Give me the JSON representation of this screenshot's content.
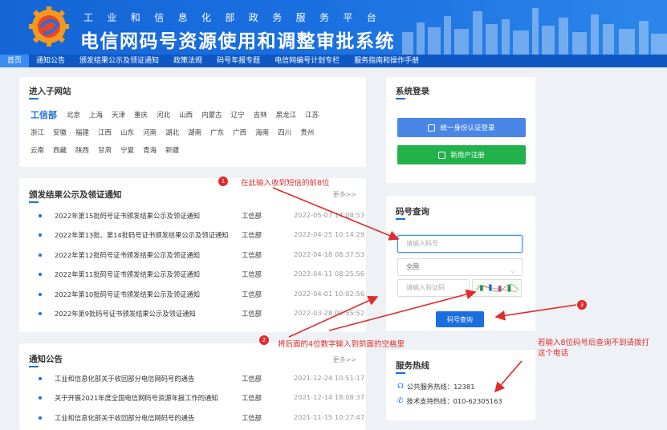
{
  "header": {
    "subtitle": "工业和信息化部政务服务平台",
    "title": "电信网码号资源使用和调整审批系统"
  },
  "nav": [
    "首页",
    "通知公告",
    "颁发结果公示及领证通知",
    "政策法规",
    "码号年报专题",
    "电信网编号计划专栏",
    "服务指南和操作手册"
  ],
  "subsites": {
    "title": "进入子网站",
    "rows": [
      [
        "工信部",
        "北京",
        "上海",
        "天津",
        "重庆",
        "河北",
        "山西",
        "内蒙古",
        "辽宁",
        "吉林",
        "黑龙江",
        "江苏"
      ],
      [
        "浙江",
        "安徽",
        "福建",
        "江西",
        "山东",
        "河南",
        "湖北",
        "湖南",
        "广东",
        "广西",
        "海南",
        "四川",
        "贵州"
      ],
      [
        "云南",
        "西藏",
        "陕西",
        "甘肃",
        "宁夏",
        "青海",
        "新疆"
      ]
    ]
  },
  "results": {
    "title": "颁发结果公示及领证通知",
    "more": "更多>>",
    "items": [
      {
        "title": "2022年第15批码号证书颁发结果公示及领证通知",
        "org": "工信部",
        "date": "2022-05-07 14:08:53"
      },
      {
        "title": "2022年第13批、第14批码号证书颁发结果公示及领证通知",
        "org": "工信部",
        "date": "2022-04-25 10:14:29"
      },
      {
        "title": "2022年第12批码号证书颁发结果公示及领证通知",
        "org": "工信部",
        "date": "2022-04-18 08:37:53"
      },
      {
        "title": "2022年第11批码号证书颁发结果公示及领证通知",
        "org": "工信部",
        "date": "2022-04-11 08:25:56"
      },
      {
        "title": "2022年第10批码号证书颁发结果公示及领证通知",
        "org": "工信部",
        "date": "2022-04-01 10:02:56"
      },
      {
        "title": "2022年第9批码号证书颁发结果公示及领证通知",
        "org": "工信部",
        "date": "2022-03-28 09:55:52"
      }
    ]
  },
  "notices": {
    "title": "通知公告",
    "more": "更多>>",
    "items": [
      {
        "title": "工业和信息化部关于收回部分电信网码号的通告",
        "org": "工信部",
        "date": "2021-12-24 10:51:17"
      },
      {
        "title": "关于开展2021年度全国电信网码号资源年报工作的通知",
        "org": "工信部",
        "date": "2021-12-14 18:08:37"
      },
      {
        "title": "工业和信息化部关于收回部分电信网码号的通告",
        "org": "工信部",
        "date": "2021-11-15 10:27:47"
      }
    ]
  },
  "login": {
    "title": "系统登录",
    "unified_login": "统一身份认证登录",
    "new_user": "新用户注册"
  },
  "query": {
    "title": "码号查询",
    "code_placeholder": "请输入码号",
    "region": "全国",
    "captcha_placeholder": "请输入验证码",
    "button": "码号查询"
  },
  "hotline": {
    "title": "服务热线",
    "public": "公共服务热线：12381",
    "tech": "技术支持热线：010-62305163"
  },
  "annotations": {
    "a1": "在此输入收到短信的前8位",
    "a2": "将后面的4位数字输入到前面的空格里",
    "a3": "若输入8位码号后查询不到请拨打这个电话",
    "n1": "1",
    "n2": "2",
    "n3": "3"
  },
  "colors": {
    "brand": "#1a6fe0",
    "nav": "#0f58c4",
    "green": "#22b24c",
    "annotation": "#e02b2b"
  }
}
